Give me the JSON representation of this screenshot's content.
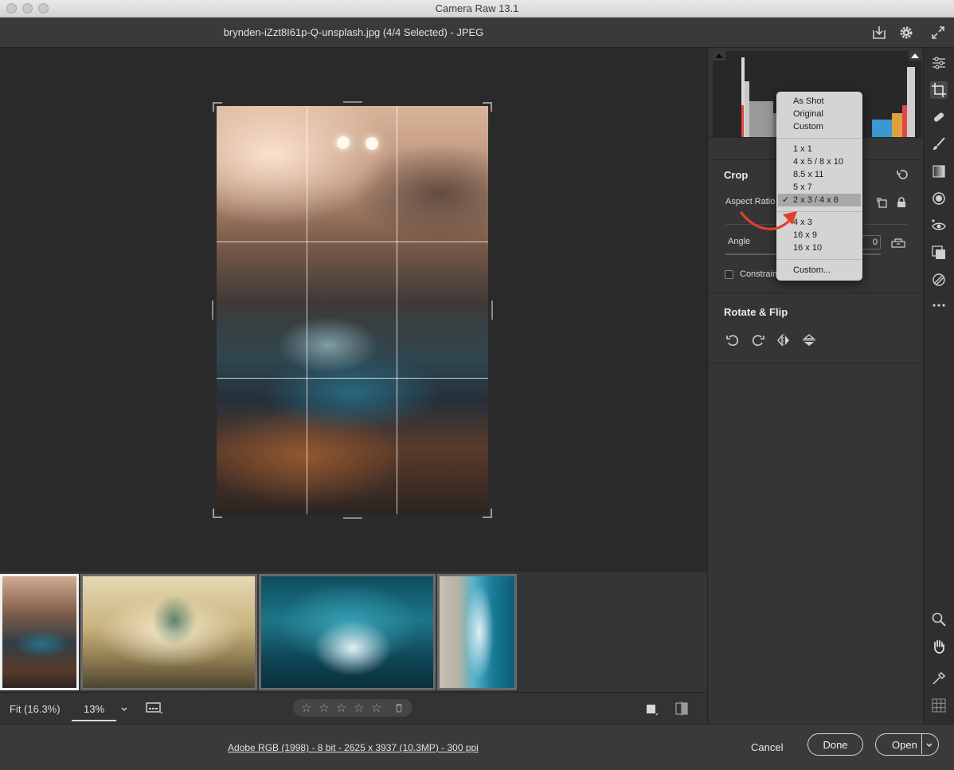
{
  "window": {
    "title": "Camera Raw 13.1"
  },
  "header": {
    "filename": "brynden-iZzt8I61p-Q-unsplash.jpg (4/4 Selected)  -  JPEG"
  },
  "filmstrip": {
    "thumbnails": [
      "thumb-1",
      "thumb-2",
      "thumb-3",
      "thumb-4"
    ],
    "selected_index": 0
  },
  "toolbar": {
    "fit_label": "Fit (16.3%)",
    "zoom_value": "13%",
    "rating_stars": [
      "☆",
      "☆",
      "☆",
      "☆",
      "☆"
    ]
  },
  "status": {
    "image_info": "Adobe RGB (1998) - 8 bit - 2625 x 3937 (10.3MP) - 300 ppi",
    "cancel_label": "Cancel",
    "done_label": "Done",
    "open_label": "Open"
  },
  "crop_panel": {
    "title": "Crop",
    "aspect_ratio_label": "Aspect Ratio",
    "angle_label": "Angle",
    "angle_value": "0",
    "constrain_label": "Constrain to image",
    "constrain_checked": false
  },
  "rotate_panel": {
    "title": "Rotate & Flip"
  },
  "aspect_menu": {
    "groups": [
      [
        "As Shot",
        "Original",
        "Custom"
      ],
      [
        "1 x 1",
        "4 x 5 / 8 x 10",
        "8.5 x 11",
        "5 x 7",
        "2 x 3 / 4 x 6"
      ],
      [
        "4 x 3",
        "16 x 9",
        "16 x 10"
      ],
      [
        "Custom..."
      ]
    ],
    "selected": "2 x 3 / 4 x 6",
    "check_glyph": "✓"
  },
  "colors": {
    "accent_arrow": "#e0402a",
    "panel_bg": "#353535",
    "canvas_bg": "#2a2a2a"
  }
}
